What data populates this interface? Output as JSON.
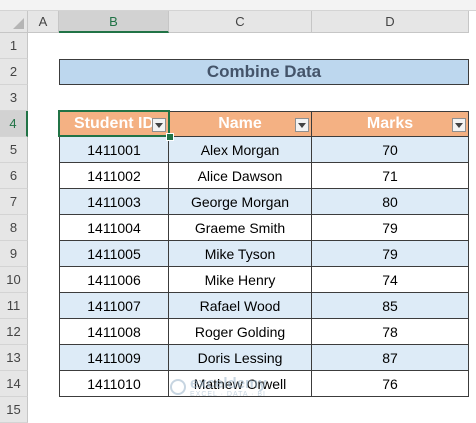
{
  "columns": [
    "A",
    "B",
    "C",
    "D"
  ],
  "rows": [
    "1",
    "2",
    "3",
    "4",
    "5",
    "6",
    "7",
    "8",
    "9",
    "10",
    "11",
    "12",
    "13",
    "14",
    "15"
  ],
  "title": "Combine Data",
  "headers": {
    "student_id": "Student ID",
    "name": "Name",
    "marks": "Marks"
  },
  "records": [
    {
      "id": "1411001",
      "name": "Alex Morgan",
      "marks": "70"
    },
    {
      "id": "1411002",
      "name": "Alice Dawson",
      "marks": "71"
    },
    {
      "id": "1411003",
      "name": "George Morgan",
      "marks": "80"
    },
    {
      "id": "1411004",
      "name": "Graeme Smith",
      "marks": "79"
    },
    {
      "id": "1411005",
      "name": "Mike Tyson",
      "marks": "79"
    },
    {
      "id": "1411006",
      "name": "Mike Henry",
      "marks": "74"
    },
    {
      "id": "1411007",
      "name": "Rafael Wood",
      "marks": "85"
    },
    {
      "id": "1411008",
      "name": "Roger Golding",
      "marks": "78"
    },
    {
      "id": "1411009",
      "name": "Doris Lessing",
      "marks": "87"
    },
    {
      "id": "1411010",
      "name": "Mathew Orwell",
      "marks": "76"
    }
  ],
  "watermark": {
    "name": "exceldemy",
    "tagline": "EXCEL · DATA · BI"
  },
  "colors": {
    "title_fill": "#bdd7ee",
    "header_fill": "#f4b183",
    "band_fill": "#ddebf7",
    "selection": "#217346"
  },
  "selected_cell": "B4"
}
